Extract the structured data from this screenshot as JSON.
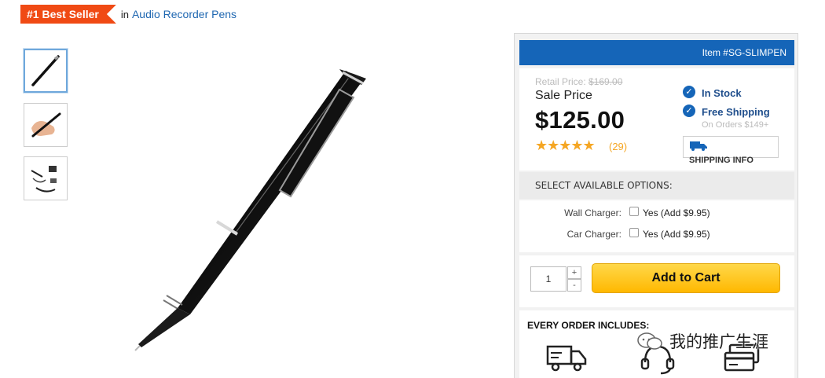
{
  "badge": {
    "label": "#1 Best Seller",
    "in_text": "in",
    "category_link": "Audio Recorder Pens",
    "color": "#f04a14"
  },
  "thumbnails": [
    {
      "name": "pen-only"
    },
    {
      "name": "pen-in-hand"
    },
    {
      "name": "pen-accessories"
    }
  ],
  "product": {
    "item_number": "Item #SG-SLIMPEN",
    "retail_label": "Retail Price:",
    "retail_price": "$169.00",
    "sale_label": "Sale Price",
    "sale_price": "$125.00",
    "stars": "★★★★★",
    "rating": 5,
    "review_count": "(29)",
    "in_stock": "In Stock",
    "free_shipping": "Free Shipping",
    "free_shipping_sub": "On Orders $149+",
    "shipping_info": "SHIPPING INFO"
  },
  "options": {
    "heading": "SELECT AVAILABLE OPTIONS:",
    "items": [
      {
        "label": "Wall Charger:",
        "choice": "Yes (Add $9.95)",
        "checked": false
      },
      {
        "label": "Car Charger:",
        "choice": "Yes (Add $9.95)",
        "checked": false
      }
    ]
  },
  "cart": {
    "quantity": "1",
    "up": "+",
    "down": "-",
    "button": "Add to Cart"
  },
  "every_order": {
    "heading": "EVERY ORDER INCLUDES:",
    "icons": [
      "truck-icon",
      "headset-icon",
      "credit-card-icon"
    ]
  },
  "watermark": {
    "text": "我的推广生涯"
  },
  "colors": {
    "accent_blue": "#1565b8",
    "star_orange": "#f5a623",
    "cart_yellow": "#ffc21a"
  }
}
